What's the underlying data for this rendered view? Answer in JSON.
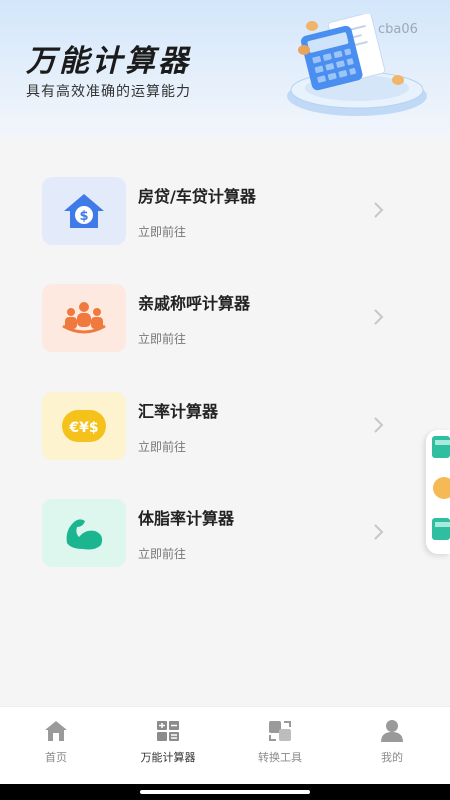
{
  "header": {
    "title": "万能计算器",
    "subtitle": "具有高效准确的运算能力",
    "watermark": "cba06"
  },
  "calculators": [
    {
      "name": "房贷/车贷计算器",
      "action": "立即前往",
      "icon": "house-dollar-icon",
      "color": "#3f7be8"
    },
    {
      "name": "亲戚称呼计算器",
      "action": "立即前往",
      "icon": "family-icon",
      "color": "#f07a3e"
    },
    {
      "name": "汇率计算器",
      "action": "立即前往",
      "icon": "currency-icon",
      "color": "#f5c21b"
    },
    {
      "name": "体脂率计算器",
      "action": "立即前往",
      "icon": "muscle-arm-icon",
      "color": "#1bb68f"
    }
  ],
  "tabs": [
    {
      "label": "首页",
      "icon": "home-icon",
      "active": false
    },
    {
      "label": "万能计算器",
      "icon": "grid-calculator-icon",
      "active": true
    },
    {
      "label": "转换工具",
      "icon": "convert-icon",
      "active": false
    },
    {
      "label": "我的",
      "icon": "user-icon",
      "active": false
    }
  ],
  "colors": {
    "background": "#f5f5f5",
    "header_gradient_top": "#d3e6fb",
    "card_blue_bg": "#e3ebfb",
    "card_orange_bg": "#fde9df",
    "card_yellow_bg": "#fdf3cf",
    "card_green_bg": "#ddf6ee"
  }
}
